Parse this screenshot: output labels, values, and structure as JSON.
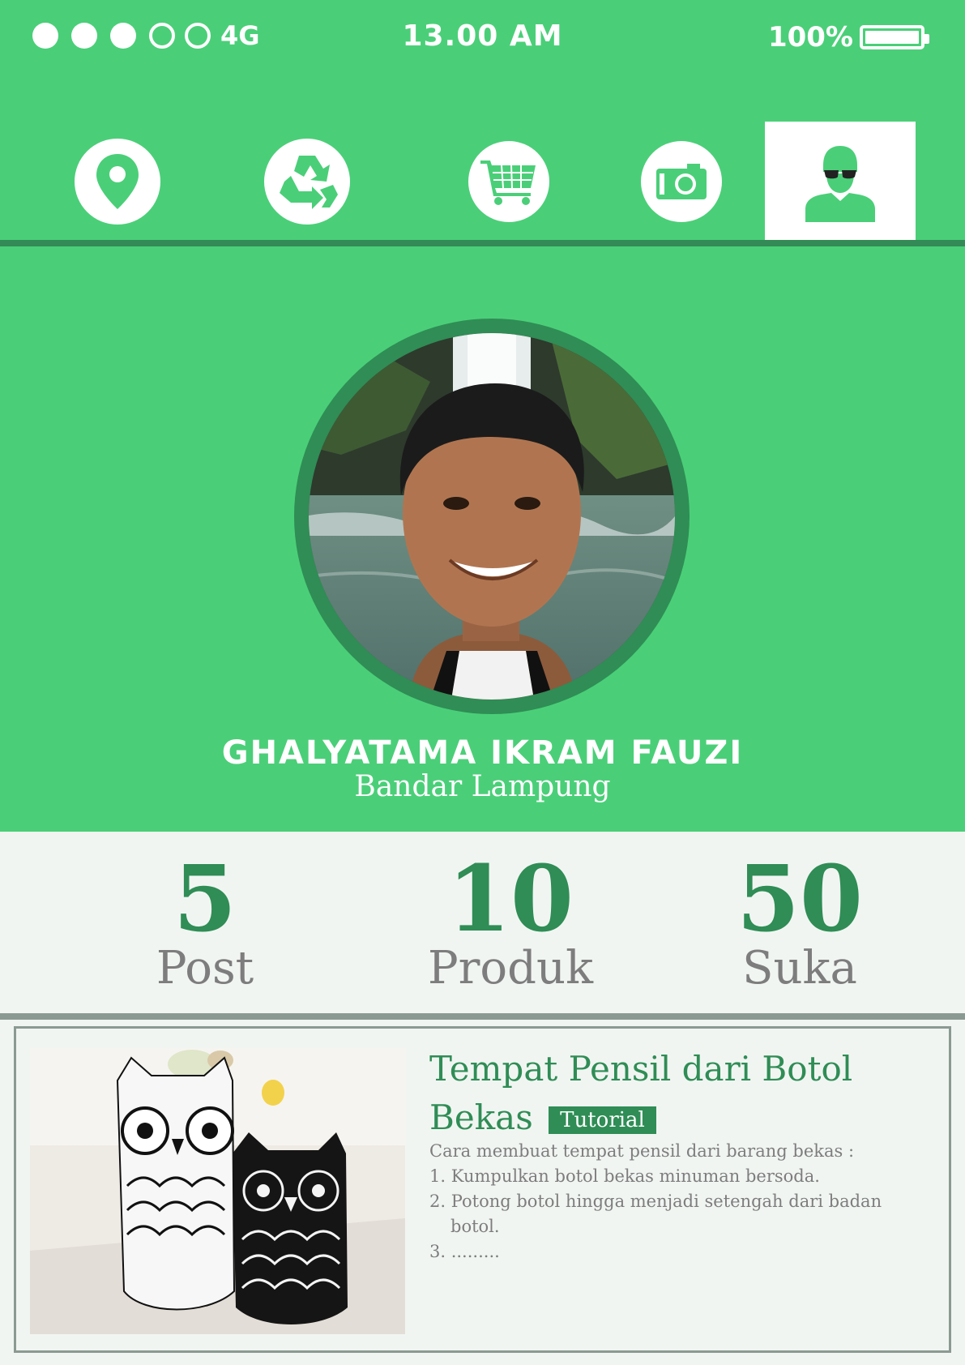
{
  "status_bar": {
    "signal_filled": 3,
    "signal_total": 5,
    "network": "4G",
    "time": "13.00 AM",
    "battery": "100%",
    "battery_level": 1.0
  },
  "nav": {
    "items": [
      {
        "icon": "location-pin-icon",
        "active": false
      },
      {
        "icon": "recycle-icon",
        "active": false
      },
      {
        "icon": "shopping-cart-icon",
        "active": false
      },
      {
        "icon": "camera-icon",
        "active": false
      },
      {
        "icon": "profile-user-icon",
        "active": true
      }
    ]
  },
  "profile": {
    "name": "GHALYATAMA IKRAM FAUZI",
    "location": "Bandar Lampung"
  },
  "stats": [
    {
      "value": "5",
      "label": "Post"
    },
    {
      "value": "10",
      "label": "Produk"
    },
    {
      "value": "50",
      "label": "Suka"
    }
  ],
  "post": {
    "title": "Tempat Pensil dari Botol Bekas",
    "tag": "Tutorial",
    "intro": "Cara membuat tempat pensil dari barang bekas :",
    "steps": [
      "1. Kumpulkan botol bekas minuman bersoda.",
      "2. Potong botol hingga menjadi setengah dari badan botol.",
      "3. ........."
    ]
  },
  "colors": {
    "primary_green": "#4acf78",
    "dark_green": "#2f8d55",
    "background": "#f1f5f2",
    "gray_text": "#7d7d7d"
  }
}
